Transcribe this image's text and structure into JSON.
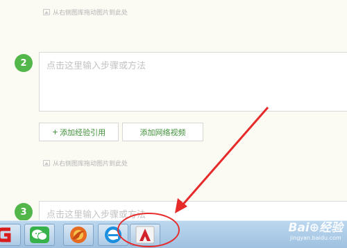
{
  "editor": {
    "drop_hint_text": "从右侧图库拖动图片到此处",
    "steps": [
      {
        "number": "2",
        "placeholder": "点击这里输入步骤或方法"
      },
      {
        "number": "3",
        "placeholder": "点击这里输入步骤或方法"
      }
    ],
    "buttons": {
      "add_reference_plus": "+",
      "add_reference_label": "添加经验引用",
      "add_video_label": "添加网络视频"
    }
  },
  "taskbar": {
    "apps": [
      {
        "name": "360-browser-icon"
      },
      {
        "name": "wechat-icon"
      },
      {
        "name": "firefox-icon"
      },
      {
        "name": "ie-browser-icon"
      },
      {
        "name": "autocad-icon"
      }
    ]
  },
  "watermark": {
    "brand": "Bai⊕经验",
    "site": "jingyan.baidu.com"
  },
  "colors": {
    "accent_green": "#53b64a",
    "annotation_red": "#e62a2a",
    "background": "#fbfaf3"
  }
}
